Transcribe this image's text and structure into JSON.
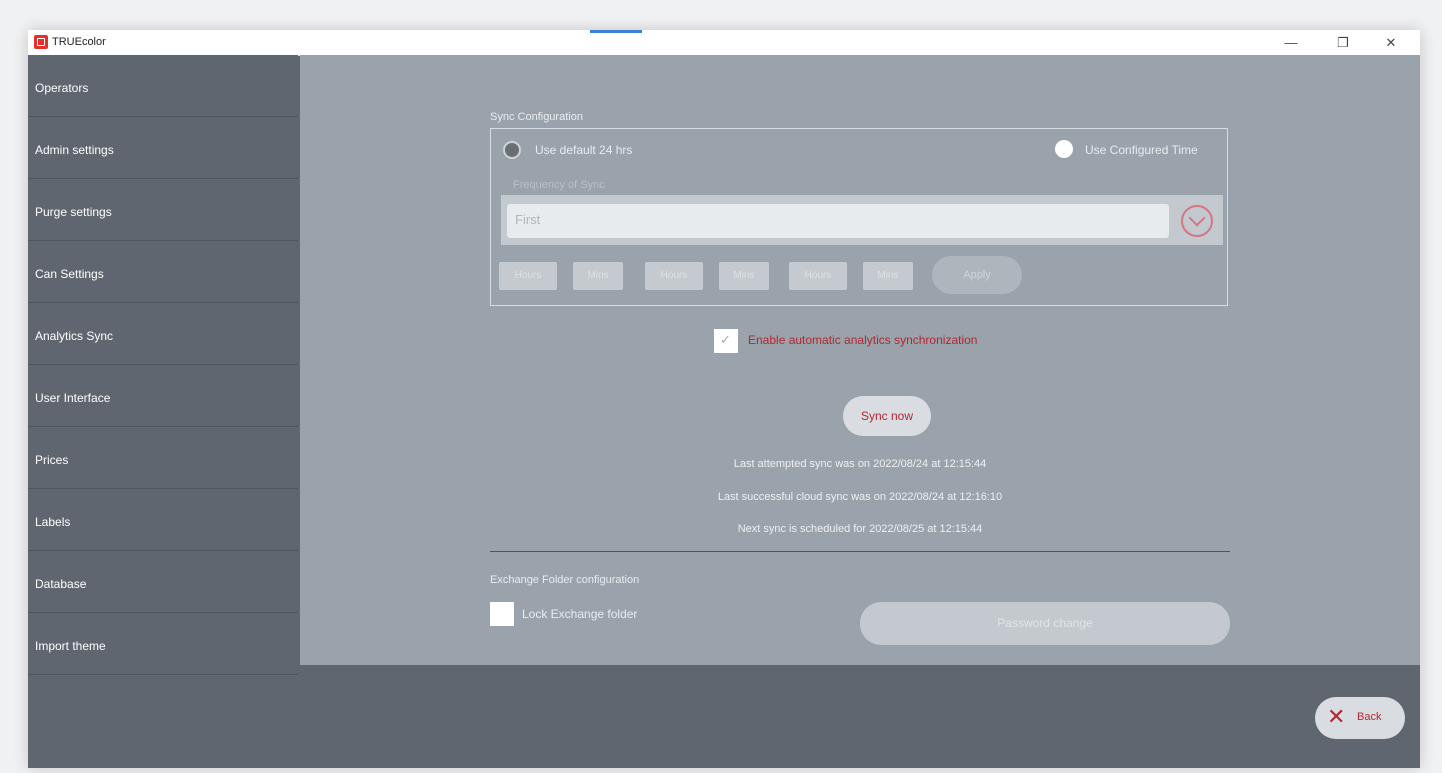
{
  "window": {
    "title": "TRUEcolor"
  },
  "window_controls": {
    "minimize": "—",
    "maximize": "❐",
    "close": "✕"
  },
  "sidebar": {
    "items": [
      {
        "label": "Operators"
      },
      {
        "label": "Admin settings"
      },
      {
        "label": "Purge settings"
      },
      {
        "label": "Can Settings"
      },
      {
        "label": "Analytics Sync"
      },
      {
        "label": "User Interface"
      },
      {
        "label": "Prices"
      },
      {
        "label": "Labels"
      },
      {
        "label": "Database"
      },
      {
        "label": "Import theme"
      }
    ]
  },
  "sync_config": {
    "title": "Sync Configuration",
    "radio_default": {
      "label": "Use default 24 hrs",
      "checked": true
    },
    "radio_configured": {
      "label": "Use Configured Time",
      "checked": false
    },
    "frequency_label": "Frequency of Sync",
    "frequency_value": "First",
    "time_boxes": [
      "Hours",
      "Mins",
      "Hours",
      "Mins",
      "Hours",
      "Mins"
    ],
    "apply_label": "Apply"
  },
  "auto_sync": {
    "label": "Enable automatic analytics synchronization",
    "checked": true
  },
  "sync_now_label": "Sync now",
  "status": {
    "last_attempted": "Last attempted sync was on 2022/08/24 at 12:15:44",
    "last_successful": "Last successful cloud sync was on 2022/08/24 at 12:16:10",
    "next_sync": "Next sync is scheduled for 2022/08/25 at 12:15:44"
  },
  "exchange": {
    "title": "Exchange Folder configuration",
    "lock_label": "Lock Exchange folder",
    "lock_checked": false,
    "password_button": "Password change"
  },
  "back_button": {
    "label": "Back"
  },
  "colors": {
    "accent_red": "#b5262f",
    "sidebar_bg": "#5f6670",
    "content_bg": "#9aa3ab"
  }
}
